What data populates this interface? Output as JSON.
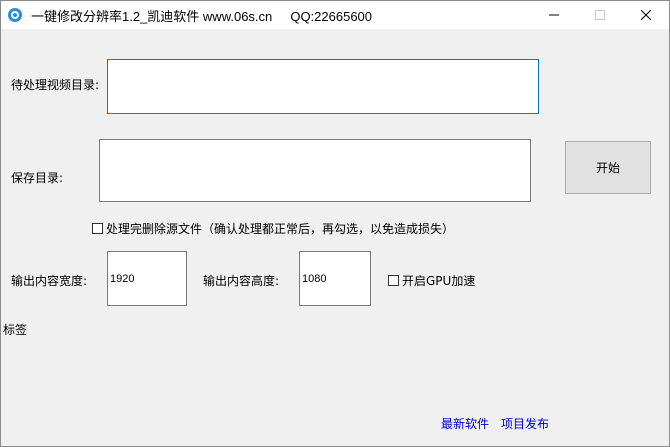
{
  "window": {
    "title": "一键修改分辨率1.2_凯迪软件 www.06s.cn     QQ:22665600"
  },
  "labels": {
    "input_dir": "待处理视频目录:",
    "save_dir": "保存目录:",
    "width": "输出内容宽度:",
    "height": "输出内容高度:",
    "tag": "标签"
  },
  "fields": {
    "input_dir_value": "",
    "save_dir_value": "",
    "width_value": "1920",
    "height_value": "1080"
  },
  "buttons": {
    "start": "开始"
  },
  "checkboxes": {
    "delete_source": "处理完删除源文件（确认处理都正常后，再勾选，以免造成损失）",
    "gpu": "开启GPU加速"
  },
  "links": {
    "new_software": "最新软件",
    "project_release": "项目发布"
  },
  "colors": {
    "accent": "#0078d7",
    "link": "#0000cc"
  },
  "icons": {
    "app": "app-logo-icon",
    "minimize": "minimize-icon",
    "maximize": "maximize-icon",
    "close": "close-icon"
  }
}
